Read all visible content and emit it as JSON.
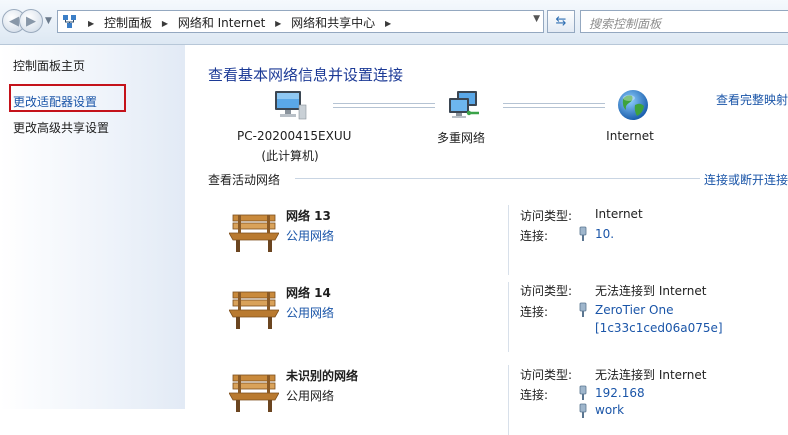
{
  "nav": {
    "back_glyph": "◀",
    "forward_glyph": "▶"
  },
  "breadcrumb": [
    "控制面板",
    "网络和 Internet",
    "网络和共享中心"
  ],
  "search": {
    "placeholder": "搜索控制面板"
  },
  "sidebar": {
    "items": [
      {
        "label": "控制面板主页"
      },
      {
        "label": "更改适配器设置",
        "highlighted": true
      },
      {
        "label": "更改高级共享设置"
      }
    ]
  },
  "main": {
    "title": "查看基本网络信息并设置连接",
    "full_map_link": "查看完整映射",
    "map": {
      "computer_name": "PC-20200415EXUU",
      "computer_sub": "(此计算机)",
      "middle_label": "多重网络",
      "internet_label": "Internet"
    },
    "active_header": "查看活动网络",
    "connect_link": "连接或断开连接",
    "networks": [
      {
        "name": "网络  13",
        "type": "公用网络",
        "type_is_link": true,
        "access_key": "访问类型:",
        "access_value": "Internet",
        "conn_key": "连接:",
        "conn_values": [
          "10."
        ]
      },
      {
        "name": "网络  14",
        "type": "公用网络",
        "type_is_link": true,
        "access_key": "访问类型:",
        "access_value": "无法连接到 Internet",
        "conn_key": "连接:",
        "conn_values": [
          "ZeroTier One",
          "[1c33c1ced06a075e]"
        ]
      },
      {
        "name": "未识别的网络",
        "type": "公用网络",
        "type_is_link": false,
        "access_key": "访问类型:",
        "access_value": "无法连接到 Internet",
        "conn_key": "连接:",
        "conn_values": [
          "192.168",
          "work"
        ]
      }
    ]
  },
  "colors": {
    "link": "#1a55a8",
    "title": "#1c3a96",
    "highlight_box": "#c4121a",
    "sidebar_bg": "#e2eaf5"
  },
  "icons": [
    "back-icon",
    "forward-icon",
    "network-folder-icon",
    "refresh-icon",
    "computer-icon",
    "multi-network-icon",
    "globe-icon",
    "bench-icon",
    "plug-icon"
  ]
}
